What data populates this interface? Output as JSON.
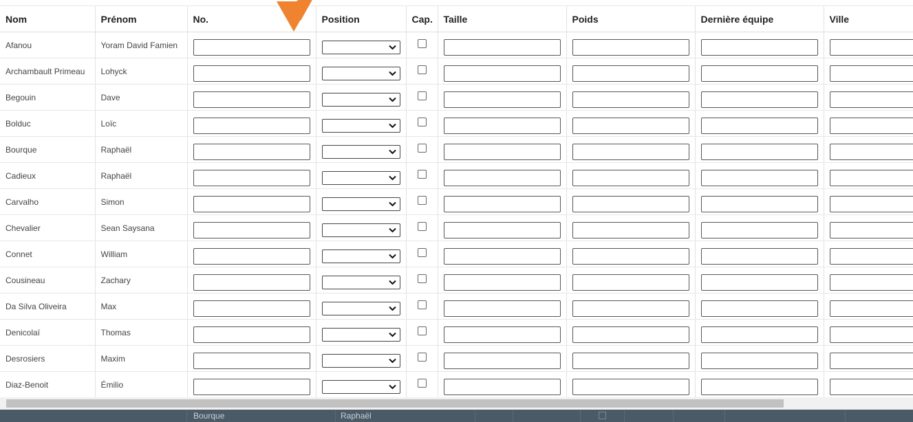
{
  "table": {
    "headers": {
      "nom": "Nom",
      "prenom": "Prénom",
      "no": "No.",
      "position": "Position",
      "cap": "Cap.",
      "taille": "Taille",
      "poids": "Poids",
      "derniere_equipe": "Dernière équipe",
      "ville": "Ville"
    },
    "rows": [
      {
        "nom": "Afanou",
        "prenom": "Yoram David Famien"
      },
      {
        "nom": "Archambault Primeau",
        "prenom": "Lohyck"
      },
      {
        "nom": "Begouin",
        "prenom": "Dave"
      },
      {
        "nom": "Bolduc",
        "prenom": "Loïc"
      },
      {
        "nom": "Bourque",
        "prenom": "Raphaël"
      },
      {
        "nom": "Cadieux",
        "prenom": "Raphaël"
      },
      {
        "nom": "Carvalho",
        "prenom": "Simon"
      },
      {
        "nom": "Chevalier",
        "prenom": "Sean Saysana"
      },
      {
        "nom": "Connet",
        "prenom": "William"
      },
      {
        "nom": "Cousineau",
        "prenom": "Zachary"
      },
      {
        "nom": "Da Silva Oliveira",
        "prenom": "Max"
      },
      {
        "nom": "Denicolaï",
        "prenom": "Thomas"
      },
      {
        "nom": "Desrosiers",
        "prenom": "Maxim"
      },
      {
        "nom": "Diaz-Benoit",
        "prenom": "Émilio"
      }
    ]
  },
  "bottom_bar": {
    "nom": "Bourque",
    "prenom": "Raphaël"
  },
  "colors": {
    "annotation_arrow": "#f0832f",
    "bottom_bar_bg": "#4a5a66"
  },
  "icons": {
    "dropdown": "chevron-down-icon",
    "annotation": "arrow-pointer-icon"
  }
}
